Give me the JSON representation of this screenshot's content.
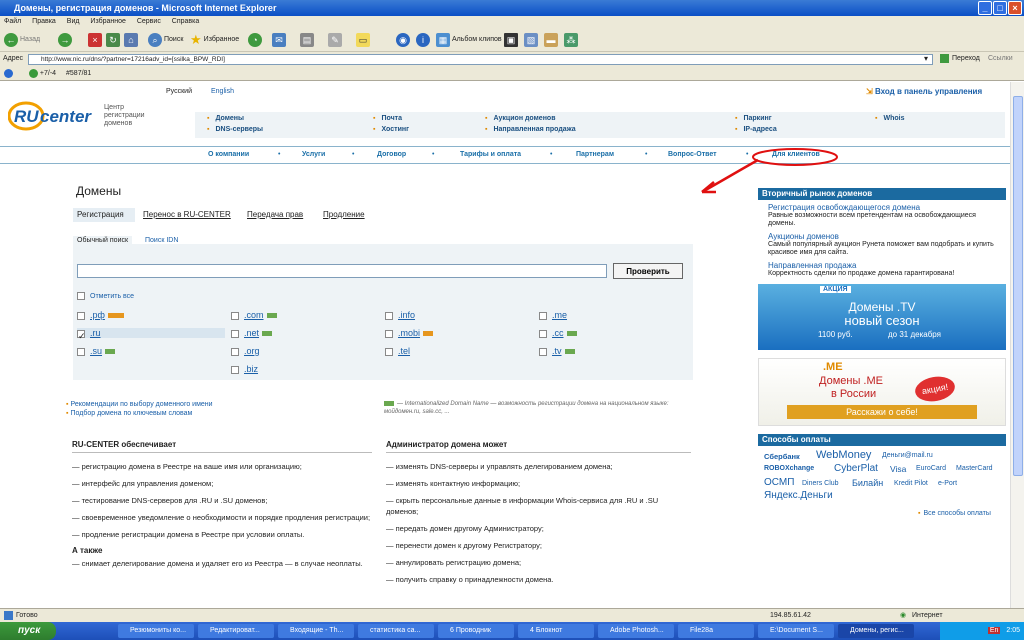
{
  "window": {
    "title": "Домены, регистрация доменов - Microsoft Internet Explorer"
  },
  "menu": [
    "Файл",
    "Правка",
    "Вид",
    "Избранное",
    "Сервис",
    "Справка"
  ],
  "toolbar": {
    "back": "Назад",
    "search": "Поиск",
    "favorites": "Избранное",
    "album": "Альбом клипов"
  },
  "address": {
    "label": "Адрес",
    "url": "http://www.nic.ru/dns/?partner=17216adv_id=[ssilka_BPW_RDI]",
    "go": "Переход",
    "links": "Ссылки"
  },
  "linksbar": {
    "rating": "+7/-4",
    "count": "#587/81"
  },
  "site": {
    "logo_text": "RU-center",
    "logo_caption": "Центр регистрации доменов",
    "lang_ru": "Русский",
    "lang_en": "English",
    "login": "Вход в панель управления",
    "topnav": [
      [
        "Домены",
        "DNS-серверы"
      ],
      [
        "Почта",
        "Хостинг"
      ],
      [
        "Аукцион доменов",
        "Направленная продажа"
      ],
      [
        "Паркинг",
        "IP-адреса"
      ],
      [
        "Whois"
      ]
    ],
    "navbar": [
      "О компании",
      "Услуги",
      "Договор",
      "Тарифы и оплата",
      "Партнерам",
      "Вопрос-Ответ",
      "Для клиентов"
    ]
  },
  "main": {
    "heading": "Домены",
    "tabs": [
      "Регистрация",
      "Перенос в RU-CENTER",
      "Передача прав",
      "Продление"
    ],
    "search_tabs": [
      "Обычный поиск",
      "Поиск IDN"
    ],
    "search_value": "",
    "check_button": "Проверить",
    "select_all": "Отметить все",
    "zones": [
      {
        "name": ".рф",
        "checked": false,
        "badge": "hot"
      },
      {
        "name": ".com",
        "checked": false,
        "badge": "idn"
      },
      {
        "name": ".info",
        "checked": false,
        "badge": ""
      },
      {
        "name": ".me",
        "checked": false,
        "badge": ""
      },
      {
        "name": ".ru",
        "checked": true,
        "badge": ""
      },
      {
        "name": ".net",
        "checked": false,
        "badge": "idn"
      },
      {
        "name": ".mobi",
        "checked": false,
        "badge": "new"
      },
      {
        "name": ".cc",
        "checked": false,
        "badge": "idn"
      },
      {
        "name": ".su",
        "checked": false,
        "badge": "idn"
      },
      {
        "name": ".org",
        "checked": false,
        "badge": ""
      },
      {
        "name": ".tel",
        "checked": false,
        "badge": ""
      },
      {
        "name": ".tv",
        "checked": false,
        "badge": "idn"
      },
      {
        "name": ".biz",
        "checked": false,
        "badge": ""
      }
    ],
    "reco1": "Рекомендации по выбору доменного имени",
    "reco2": "Подбор домена по ключевым словам",
    "idn_note": "— Internationalized Domain Name — возможность регистрации домена на национальном языке: мойдомен.ru, sale.cc, ...",
    "left_col": {
      "title": "RU-CENTER обеспечивает",
      "items": [
        "— регистрацию домена в Реестре на ваше имя или организацию;",
        "— интерфейс для управления доменом;",
        "— тестирование DNS-серверов для .RU и .SU доменов;",
        "— своевременное уведомление о необходимости и порядке продления регистрации;",
        "— продление регистрации домена в Реестре при условии оплаты."
      ],
      "also_title": "А также",
      "also_item": "— снимает делегирование домена и удаляет его из Реестра — в случае неоплаты."
    },
    "right_col": {
      "title": "Администратор домена может",
      "items": [
        "— изменять DNS-серверы и управлять делегированием домена;",
        "— изменять контактную информацию;",
        "— скрыть персональные данные в информации Whois-сервиса для .RU и .SU доменов;",
        "— передать домен другому Администратору;",
        "— перенести домен к другому Регистратору;",
        "— аннулировать регистрацию домена;",
        "— получить справку о принадлежности домена."
      ]
    }
  },
  "sidebar": {
    "market_title": "Вторичный рынок доменов",
    "market_items": [
      {
        "link": "Регистрация освобождающегося домена",
        "desc": "Равные возможности всем претендентам на освобождающиеся домены."
      },
      {
        "link": "Аукционы доменов",
        "desc": "Самый популярный аукцион Рунета поможет вам подобрать и купить красивое имя для сайта."
      },
      {
        "link": "Направленная продажа",
        "desc": "Корректность сделки по продаже домена гарантирована!"
      }
    ],
    "banner_tv": {
      "tag": "АКЦИЯ",
      "line1": "Домены .TV",
      "line2": "новый сезон",
      "line3": "1100 руб.",
      "line4": "до 31 декабря"
    },
    "banner_me": {
      "line1": "Домены .ME",
      "line2": "в России",
      "tag": "акция!",
      "cta": "Расскажи о себе!"
    },
    "pay_title": "Способы оплаты",
    "pay_methods": [
      "Сбербанк",
      "WebMoney",
      "Деньги@mail.ru",
      "ROBOXchange",
      "CyberPlat",
      "Visa",
      "EuroCard",
      "MasterCard",
      "ОСМП",
      "Diners Club",
      "Билайн",
      "Kredit Pilot",
      "e-Port",
      "Яндекс.Деньги"
    ],
    "pay_all": "Все способы оплаты"
  },
  "status": {
    "text": "Готово",
    "ip": "194.85.61.42",
    "zone": "Интернет"
  },
  "taskbar": {
    "start": "пуск",
    "tasks": [
      "Резюмониты ко...",
      "Редактироват...",
      "Входящие - Th...",
      "статистика са...",
      "6 Проводник",
      "4 Блокнот",
      "Adobe Photosh...",
      "File28a",
      "E:\\Document S...",
      "Домены, регис..."
    ],
    "lang": "En",
    "time": "2:05"
  }
}
